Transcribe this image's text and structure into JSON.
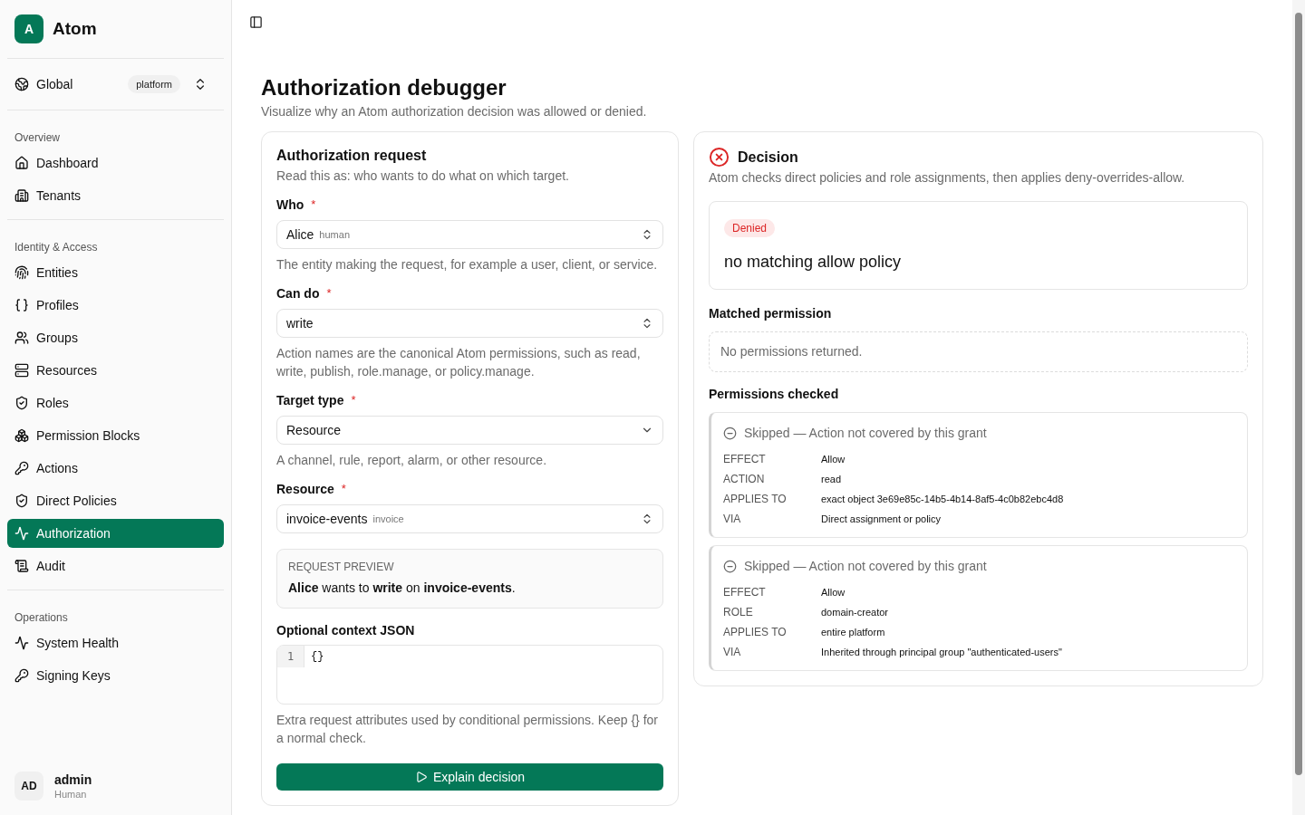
{
  "sidebar": {
    "brand": {
      "initial": "A",
      "name": "Atom"
    },
    "scope": {
      "label": "Global",
      "badge": "platform"
    },
    "sections": [
      {
        "title": "Overview",
        "items": [
          {
            "label": "Dashboard",
            "selected": false
          },
          {
            "label": "Tenants",
            "selected": false
          }
        ]
      },
      {
        "title": "Identity & Access",
        "items": [
          {
            "label": "Entities",
            "selected": false
          },
          {
            "label": "Profiles",
            "selected": false
          },
          {
            "label": "Groups",
            "selected": false
          },
          {
            "label": "Resources",
            "selected": false
          },
          {
            "label": "Roles",
            "selected": false
          },
          {
            "label": "Permission Blocks",
            "selected": false
          },
          {
            "label": "Actions",
            "selected": false
          },
          {
            "label": "Direct Policies",
            "selected": false
          },
          {
            "label": "Authorization",
            "selected": true
          },
          {
            "label": "Audit",
            "selected": false
          }
        ]
      },
      {
        "title": "Operations",
        "items": [
          {
            "label": "System Health",
            "selected": false
          },
          {
            "label": "Signing Keys",
            "selected": false
          }
        ]
      }
    ],
    "user": {
      "initials": "AD",
      "name": "admin",
      "type": "Human"
    }
  },
  "page": {
    "title": "Authorization debugger",
    "subtitle": "Visualize why an Atom authorization decision was allowed or denied."
  },
  "request": {
    "title": "Authorization request",
    "subtitle": "Read this as: who wants to do what on which target.",
    "fields": [
      {
        "label": "Who",
        "required": "*",
        "kind": "combobox",
        "value": "Alice",
        "tag": "human",
        "help": "The entity making the request, for example a user, client, or service."
      },
      {
        "label": "Can do",
        "required": "*",
        "kind": "combobox",
        "value": "write",
        "help": "Action names are the canonical Atom permissions, such as read, write, publish, role.manage, or policy.manage."
      },
      {
        "label": "Target type",
        "required": "*",
        "kind": "select",
        "value": "Resource",
        "help": "A channel, rule, report, alarm, or other resource."
      },
      {
        "label": "Resource",
        "required": "*",
        "kind": "combobox",
        "value": "invoice-events",
        "tag": "invoice"
      }
    ],
    "preview": {
      "label": "REQUEST PREVIEW",
      "text": "**Alice** wants to **write** on **invoice-events**."
    },
    "context": {
      "label": "Optional context JSON",
      "lines": [
        {
          "number": "1",
          "code": "{}"
        }
      ],
      "help": "Extra request attributes used by conditional permissions. Keep {} for a normal check."
    },
    "submit": "Explain decision"
  },
  "decision": {
    "title": "Decision",
    "subtitle": "Atom checks direct policies and role assignments, then applies deny-overrides-allow.",
    "outcome": {
      "status": "Denied",
      "reason": "no matching allow policy"
    },
    "matched": {
      "title": "Matched permission",
      "empty": "No permissions returned."
    },
    "checked": {
      "title": "Permissions checked",
      "items": [
        {
          "status": "Skipped — Action not covered by this grant",
          "rows": [
            {
              "key": "EFFECT",
              "value": "Allow"
            },
            {
              "key": "ACTION",
              "value": "read"
            },
            {
              "key": "APPLIES TO",
              "value": "exact object 3e69e85c-14b5-4b14-8af5-4c0b82ebc4d8"
            },
            {
              "key": "VIA",
              "value": "Direct assignment or policy"
            }
          ]
        },
        {
          "status": "Skipped — Action not covered by this grant",
          "rows": [
            {
              "key": "EFFECT",
              "value": "Allow"
            },
            {
              "key": "ROLE",
              "value": "domain-creator"
            },
            {
              "key": "APPLIES TO",
              "value": "entire platform"
            },
            {
              "key": "VIA",
              "value": "Inherited through principal group \"authenticated-users\""
            }
          ]
        }
      ]
    }
  }
}
